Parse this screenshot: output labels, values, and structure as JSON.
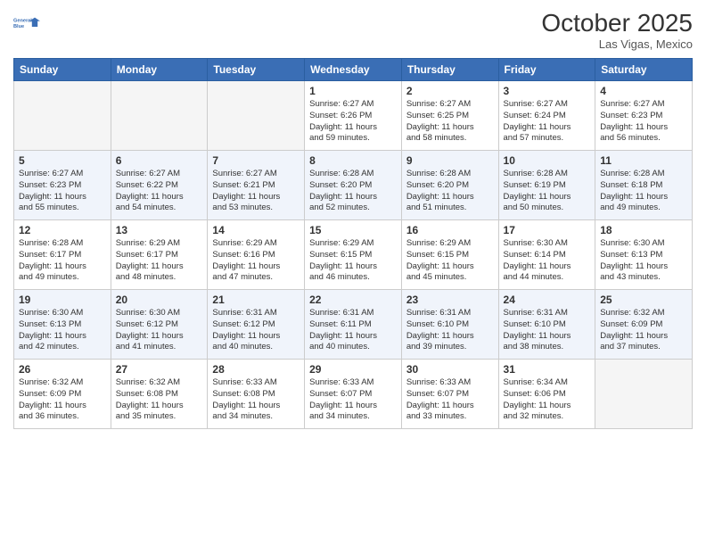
{
  "header": {
    "logo_line1": "General",
    "logo_line2": "Blue",
    "month": "October 2025",
    "location": "Las Vigas, Mexico"
  },
  "days_of_week": [
    "Sunday",
    "Monday",
    "Tuesday",
    "Wednesday",
    "Thursday",
    "Friday",
    "Saturday"
  ],
  "weeks": [
    [
      {
        "day": "",
        "info": ""
      },
      {
        "day": "",
        "info": ""
      },
      {
        "day": "",
        "info": ""
      },
      {
        "day": "1",
        "info": "Sunrise: 6:27 AM\nSunset: 6:26 PM\nDaylight: 11 hours\nand 59 minutes."
      },
      {
        "day": "2",
        "info": "Sunrise: 6:27 AM\nSunset: 6:25 PM\nDaylight: 11 hours\nand 58 minutes."
      },
      {
        "day": "3",
        "info": "Sunrise: 6:27 AM\nSunset: 6:24 PM\nDaylight: 11 hours\nand 57 minutes."
      },
      {
        "day": "4",
        "info": "Sunrise: 6:27 AM\nSunset: 6:23 PM\nDaylight: 11 hours\nand 56 minutes."
      }
    ],
    [
      {
        "day": "5",
        "info": "Sunrise: 6:27 AM\nSunset: 6:23 PM\nDaylight: 11 hours\nand 55 minutes."
      },
      {
        "day": "6",
        "info": "Sunrise: 6:27 AM\nSunset: 6:22 PM\nDaylight: 11 hours\nand 54 minutes."
      },
      {
        "day": "7",
        "info": "Sunrise: 6:27 AM\nSunset: 6:21 PM\nDaylight: 11 hours\nand 53 minutes."
      },
      {
        "day": "8",
        "info": "Sunrise: 6:28 AM\nSunset: 6:20 PM\nDaylight: 11 hours\nand 52 minutes."
      },
      {
        "day": "9",
        "info": "Sunrise: 6:28 AM\nSunset: 6:20 PM\nDaylight: 11 hours\nand 51 minutes."
      },
      {
        "day": "10",
        "info": "Sunrise: 6:28 AM\nSunset: 6:19 PM\nDaylight: 11 hours\nand 50 minutes."
      },
      {
        "day": "11",
        "info": "Sunrise: 6:28 AM\nSunset: 6:18 PM\nDaylight: 11 hours\nand 49 minutes."
      }
    ],
    [
      {
        "day": "12",
        "info": "Sunrise: 6:28 AM\nSunset: 6:17 PM\nDaylight: 11 hours\nand 49 minutes."
      },
      {
        "day": "13",
        "info": "Sunrise: 6:29 AM\nSunset: 6:17 PM\nDaylight: 11 hours\nand 48 minutes."
      },
      {
        "day": "14",
        "info": "Sunrise: 6:29 AM\nSunset: 6:16 PM\nDaylight: 11 hours\nand 47 minutes."
      },
      {
        "day": "15",
        "info": "Sunrise: 6:29 AM\nSunset: 6:15 PM\nDaylight: 11 hours\nand 46 minutes."
      },
      {
        "day": "16",
        "info": "Sunrise: 6:29 AM\nSunset: 6:15 PM\nDaylight: 11 hours\nand 45 minutes."
      },
      {
        "day": "17",
        "info": "Sunrise: 6:30 AM\nSunset: 6:14 PM\nDaylight: 11 hours\nand 44 minutes."
      },
      {
        "day": "18",
        "info": "Sunrise: 6:30 AM\nSunset: 6:13 PM\nDaylight: 11 hours\nand 43 minutes."
      }
    ],
    [
      {
        "day": "19",
        "info": "Sunrise: 6:30 AM\nSunset: 6:13 PM\nDaylight: 11 hours\nand 42 minutes."
      },
      {
        "day": "20",
        "info": "Sunrise: 6:30 AM\nSunset: 6:12 PM\nDaylight: 11 hours\nand 41 minutes."
      },
      {
        "day": "21",
        "info": "Sunrise: 6:31 AM\nSunset: 6:12 PM\nDaylight: 11 hours\nand 40 minutes."
      },
      {
        "day": "22",
        "info": "Sunrise: 6:31 AM\nSunset: 6:11 PM\nDaylight: 11 hours\nand 40 minutes."
      },
      {
        "day": "23",
        "info": "Sunrise: 6:31 AM\nSunset: 6:10 PM\nDaylight: 11 hours\nand 39 minutes."
      },
      {
        "day": "24",
        "info": "Sunrise: 6:31 AM\nSunset: 6:10 PM\nDaylight: 11 hours\nand 38 minutes."
      },
      {
        "day": "25",
        "info": "Sunrise: 6:32 AM\nSunset: 6:09 PM\nDaylight: 11 hours\nand 37 minutes."
      }
    ],
    [
      {
        "day": "26",
        "info": "Sunrise: 6:32 AM\nSunset: 6:09 PM\nDaylight: 11 hours\nand 36 minutes."
      },
      {
        "day": "27",
        "info": "Sunrise: 6:32 AM\nSunset: 6:08 PM\nDaylight: 11 hours\nand 35 minutes."
      },
      {
        "day": "28",
        "info": "Sunrise: 6:33 AM\nSunset: 6:08 PM\nDaylight: 11 hours\nand 34 minutes."
      },
      {
        "day": "29",
        "info": "Sunrise: 6:33 AM\nSunset: 6:07 PM\nDaylight: 11 hours\nand 34 minutes."
      },
      {
        "day": "30",
        "info": "Sunrise: 6:33 AM\nSunset: 6:07 PM\nDaylight: 11 hours\nand 33 minutes."
      },
      {
        "day": "31",
        "info": "Sunrise: 6:34 AM\nSunset: 6:06 PM\nDaylight: 11 hours\nand 32 minutes."
      },
      {
        "day": "",
        "info": ""
      }
    ]
  ]
}
